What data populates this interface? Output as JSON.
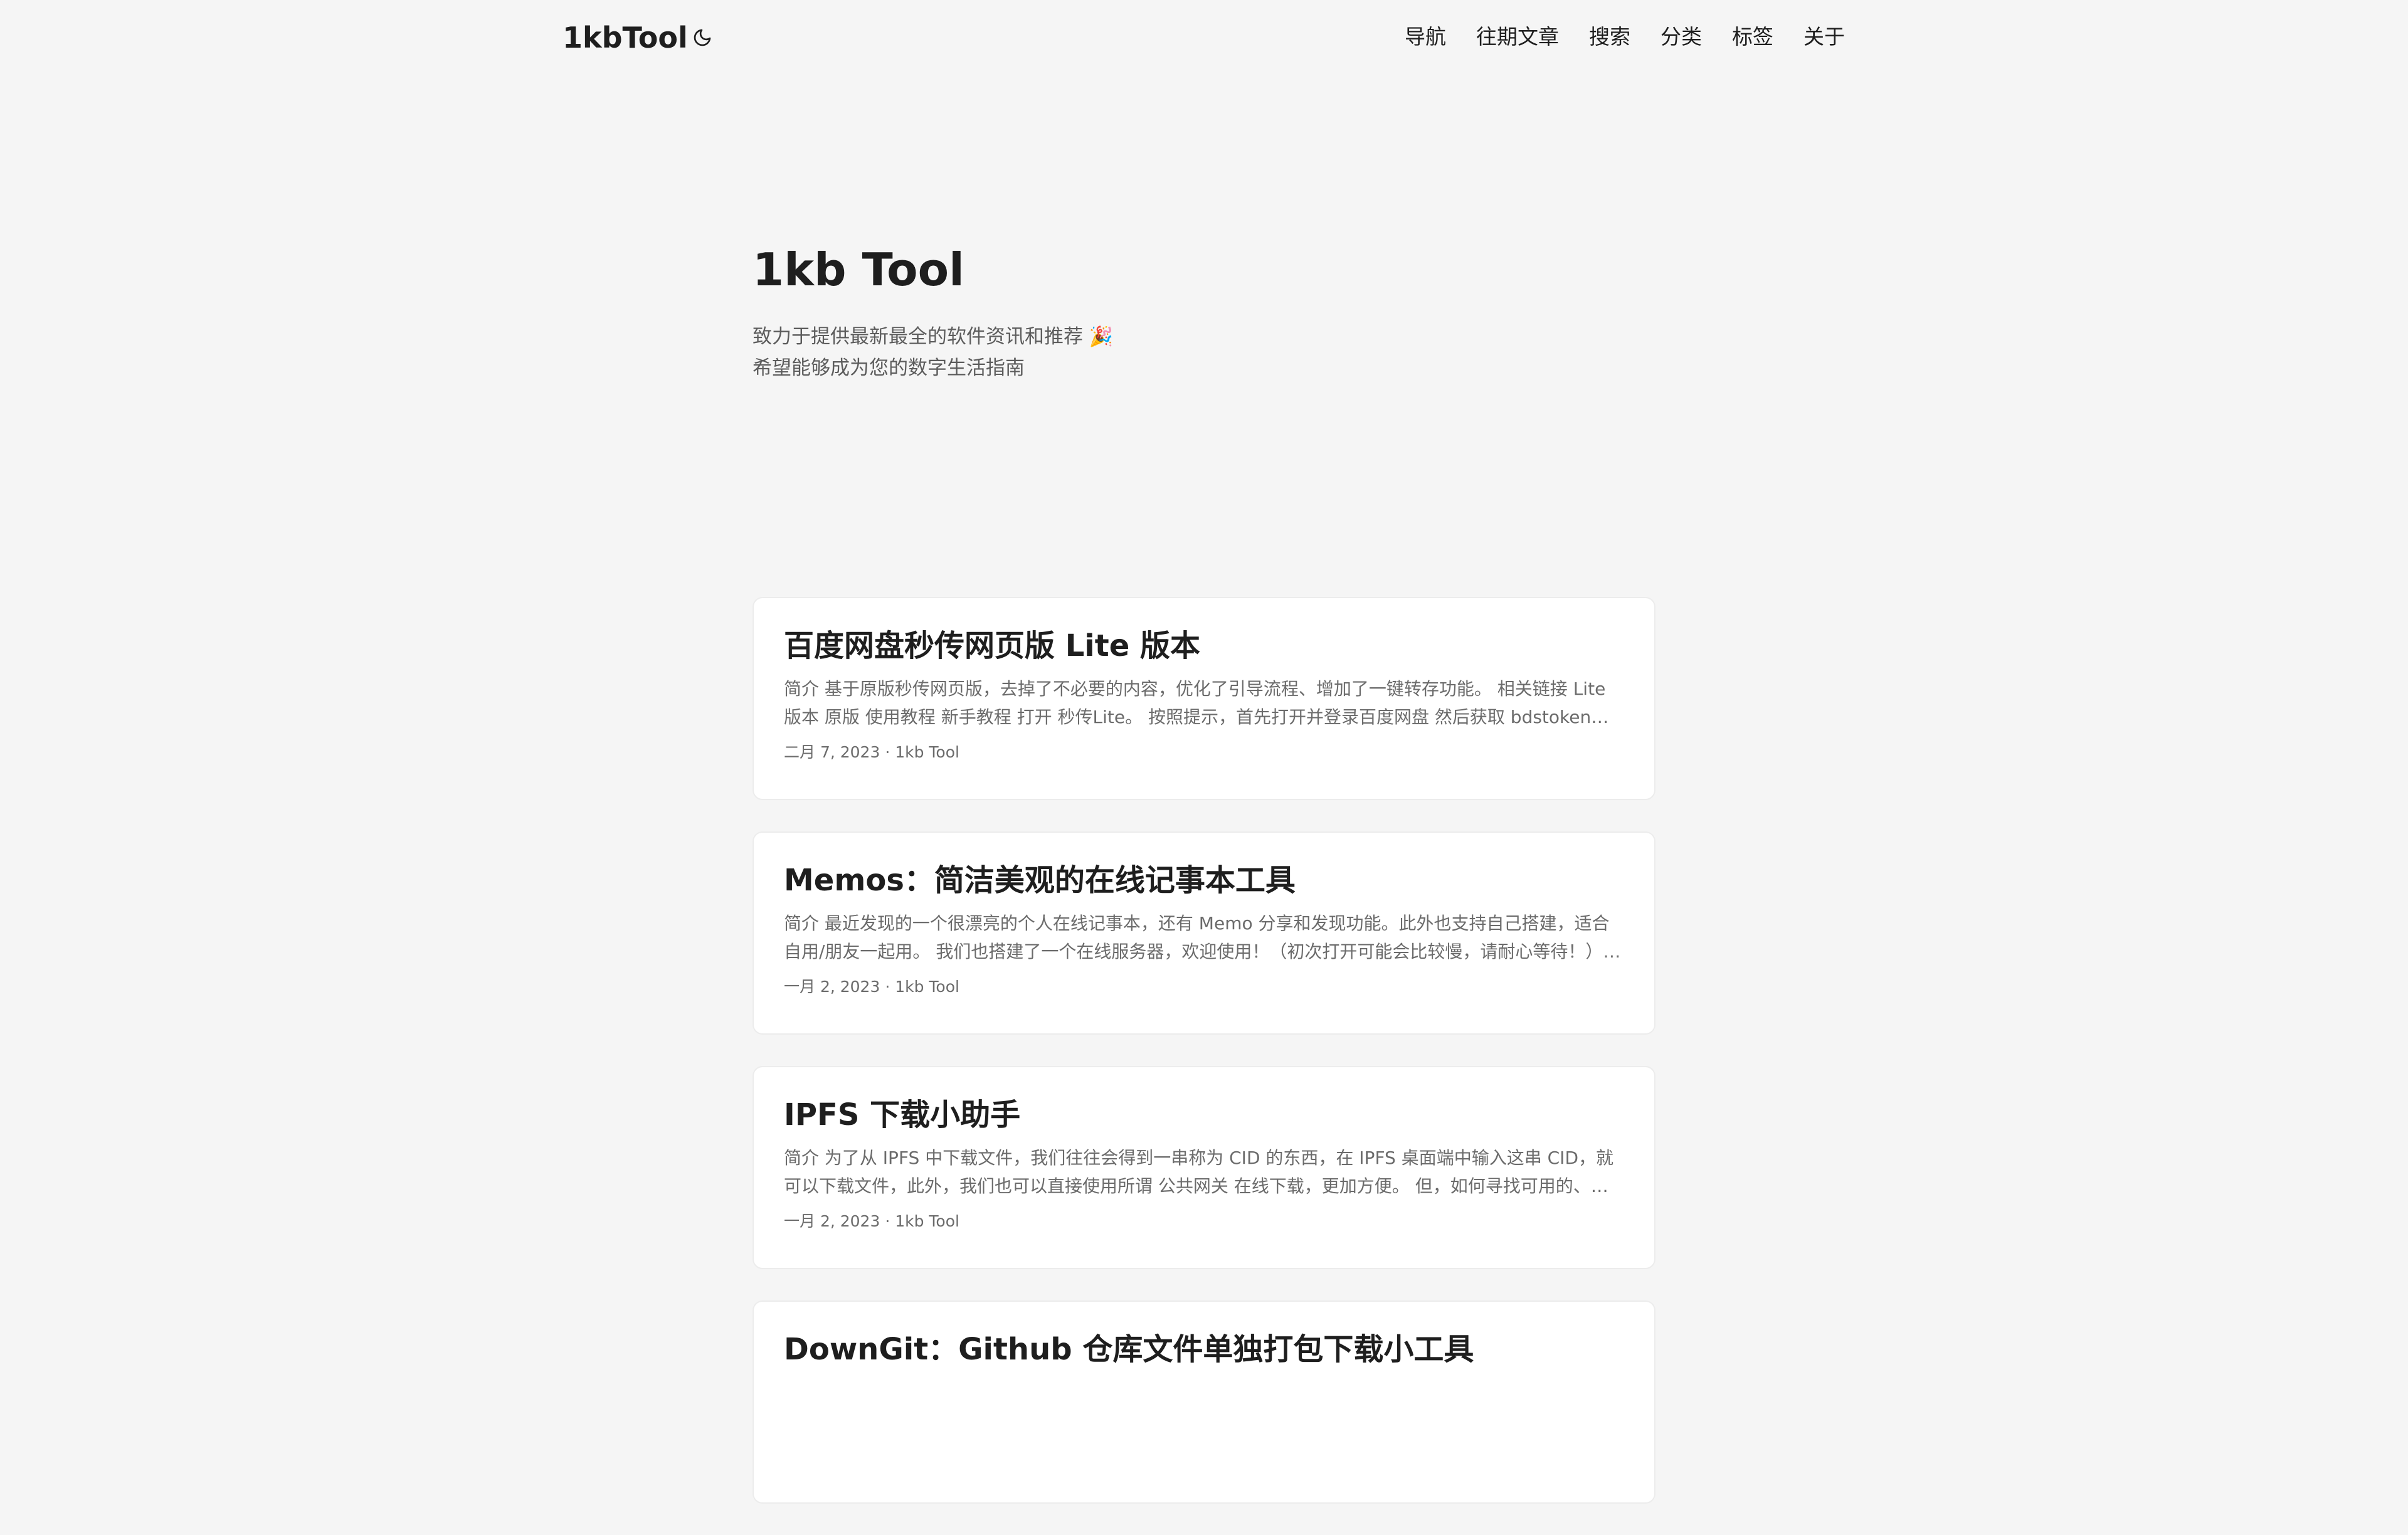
{
  "header": {
    "logo": "1kbTool",
    "theme_icon": "moon-icon",
    "menu": [
      "导航",
      "往期文章",
      "搜索",
      "分类",
      "标签",
      "关于"
    ]
  },
  "home": {
    "title": "1kb Tool",
    "desc_line1": "致力于提供最新最全的软件资讯和推荐 🎉",
    "desc_line2": "希望能够成为您的数字生活指南"
  },
  "posts": [
    {
      "title": "百度网盘秒传网页版 Lite 版本",
      "summary": "简介 基于原版秒传网页版，去掉了不必要的内容，优化了引导流程、增加了一键转存功能。 相关链接 Lite 版本 原版 使用教程 新手教程 打开 秒传Lite。 按照提示，首先打开并登录百度网盘 然后获取 bdstoken：打开…",
      "meta": "二月 7, 2023 · 1kb Tool"
    },
    {
      "title": "Memos：简洁美观的在线记事本工具",
      "summary": "简介 最近发现的一个很漂亮的个人在线记事本，还有 Memo 分享和发现功能。此外也支持自己搭建，适合自用/朋友一起用。 我们也搭建了一个在线服务器，欢迎使用！（初次打开可能会比较慢，请耐心等待！） 相…",
      "meta": "一月 2, 2023 · 1kb Tool"
    },
    {
      "title": "IPFS 下载小助手",
      "summary": "简介 为了从 IPFS 中下载文件，我们往往会得到一串称为 CID 的东西，在 IPFS 桌面端中输入这串 CID，就可以下载文件，此外，我们也可以直接使用所谓 公共网关 在线下载，更加方便。 但，如何寻找可用的、速度…",
      "meta": "一月 2, 2023 · 1kb Tool"
    },
    {
      "title": "DownGit：Github 仓库文件单独打包下载小工具",
      "summary": "",
      "meta": ""
    }
  ]
}
